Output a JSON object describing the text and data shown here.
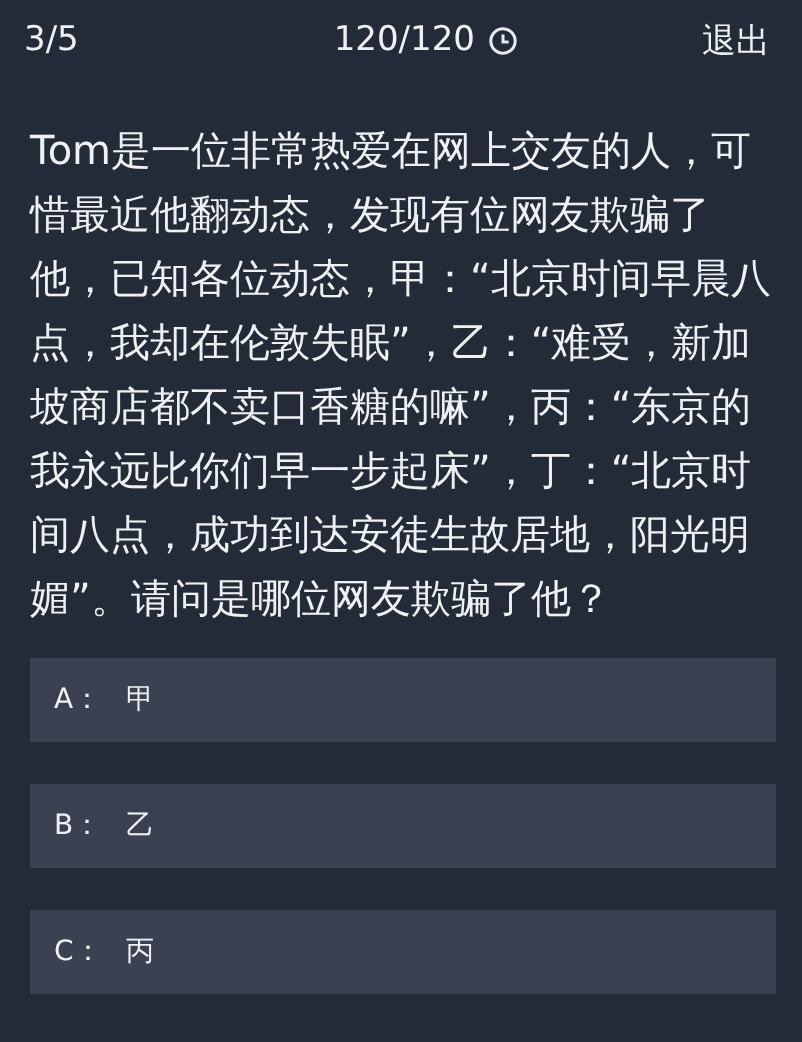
{
  "header": {
    "progress": "3/5",
    "timer": "120/120",
    "exit": "退出"
  },
  "question": "Tom是一位非常热爱在网上交友的人，可惜最近他翻动态，发现有位网友欺骗了他，已知各位动态，甲：“北京时间早晨八点，我却在伦敦失眠”，乙：“难受，新加坡商店都不卖口香糖的嘛”，丙：“东京的我永远比你们早一步起床”，丁：“北京时间八点，成功到达安徒生故居地，阳光明媚”。请问是哪位网友欺骗了他？",
  "options": [
    {
      "letter": "A：",
      "text": "甲"
    },
    {
      "letter": "B：",
      "text": "乙"
    },
    {
      "letter": "C：",
      "text": "丙"
    }
  ]
}
